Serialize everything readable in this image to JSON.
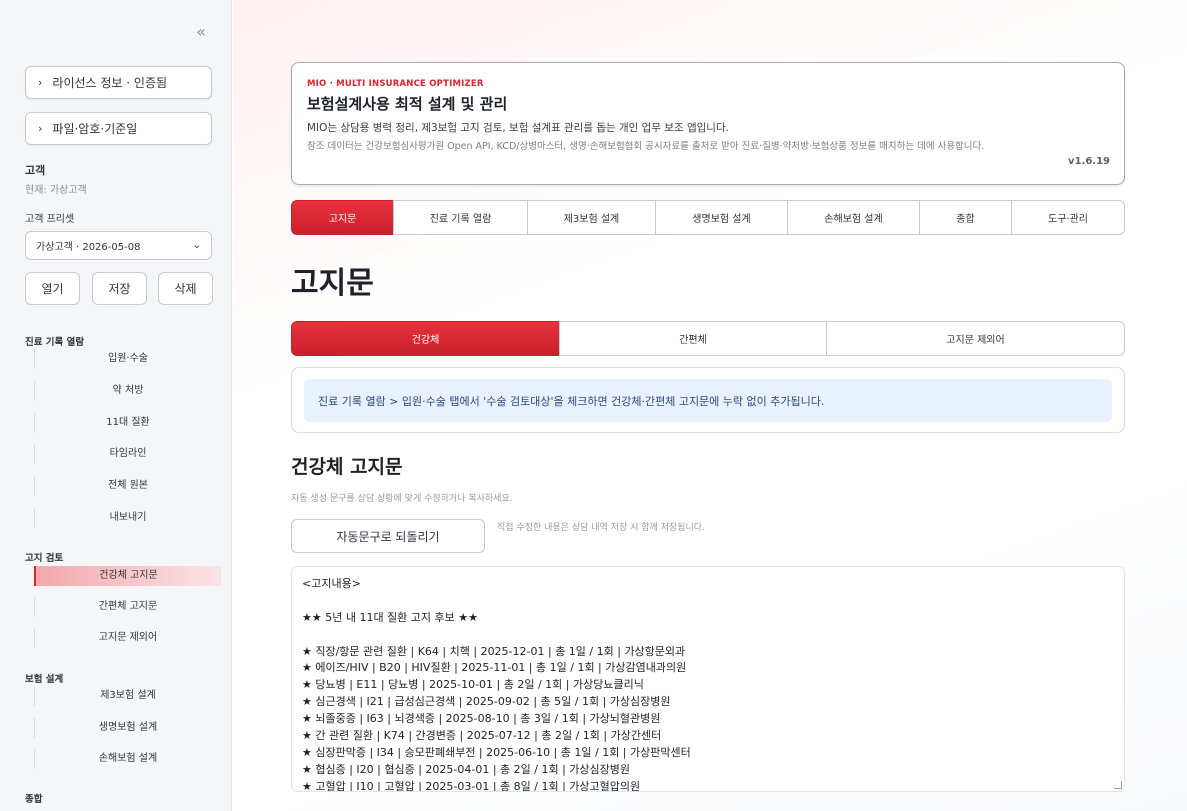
{
  "sidebar": {
    "collapse_icon": "«",
    "expanders": [
      {
        "label": "라이선스 정보 · 인증됨"
      },
      {
        "label": "파일·암호·기준일"
      }
    ],
    "customer": {
      "title": "고객",
      "current": "현재: 가상고객"
    },
    "preset": {
      "label": "고객 프리셋",
      "selected": "가상고객 · 2026-05-08"
    },
    "buttons": {
      "open": "열기",
      "save": "저장",
      "delete": "삭제"
    },
    "nav_groups": [
      {
        "title": "진료 기록 열람",
        "items": [
          "입원·수술",
          "약 처방",
          "11대 질환",
          "타임라인",
          "전체 원본",
          "내보내기"
        ]
      },
      {
        "title": "고지 검토",
        "items": [
          "건강체 고지문",
          "간편체 고지문",
          "고지문 제외어"
        ]
      },
      {
        "title": "보험 설계",
        "items": [
          "제3보험 설계",
          "생명보험 설계",
          "손해보험 설계"
        ]
      },
      {
        "title": "종합",
        "items": []
      }
    ],
    "active_nav": "건강체 고지문"
  },
  "header": {
    "eyebrow": "MIO · MULTI INSURANCE OPTIMIZER",
    "title": "보험설계사용 최적 설계 및 관리",
    "description": "MIO는 상담용 병력 정리, 제3보험 고지 검토, 보험 설계표 관리를 돕는 개인 업무 보조 앱입니다.",
    "reference": "참조 데이터는 건강보험심사평가원 Open API, KCD/상병마스터, 생명·손해보험협회 공시자료를 출처로 받아 진료·질병·약처방·보험상품 정보를 매치하는 데에 사용합니다.",
    "version": "v1.6.19"
  },
  "tabs": [
    {
      "label": "고지문",
      "active": true
    },
    {
      "label": "진료 기록 열람",
      "active": false
    },
    {
      "label": "제3보험 설계",
      "active": false
    },
    {
      "label": "생명보험 설계",
      "active": false
    },
    {
      "label": "손해보험 설계",
      "active": false
    },
    {
      "label": "종합",
      "active": false
    },
    {
      "label": "도구·관리",
      "active": false
    }
  ],
  "page_title": "고지문",
  "subtabs": [
    {
      "label": "건강체",
      "active": true
    },
    {
      "label": "간편체",
      "active": false
    },
    {
      "label": "고지문 제외어",
      "active": false
    }
  ],
  "info_message": "진료 기록 열람 > 입원·수술 탭에서 '수술 검토대상'을 체크하면 건강체·간편체 고지문에 누락 없이 추가됩니다.",
  "section": {
    "title": "건강체 고지문",
    "caption": "자동 생성 문구를 상담 상황에 맞게 수정하거나 복사하세요.",
    "reset_label": "자동문구로 되돌리기",
    "reset_note": "직접 수정한 내용은 상담 내역 저장 시 함께 저장됩니다."
  },
  "notice_text": [
    "<고지내용>",
    "",
    "★★ 5년 내 11대 질환 고지 후보 ★★",
    "",
    "★ 직장/항문 관련 질환 | K64 | 치핵 | 2025-12-01 | 총 1일 / 1회 | 가상항문외과",
    "★ 에이즈/HIV | B20 | HIV질환 | 2025-11-01 | 총 1일 / 1회 | 가상감염내과의원",
    "★ 당뇨병 | E11 | 당뇨병 | 2025-10-01 | 총 2일 / 1회 | 가상당뇨클리닉",
    "★ 심근경색 | I21 | 급성심근경색 | 2025-09-02 | 총 5일 / 1회 | 가상심장병원",
    "★ 뇌졸중증 | I63 | 뇌경색증 | 2025-08-10 | 총 3일 / 1회 | 가상뇌혈관병원",
    "★ 간 관련 질환 | K74 | 간경변증 | 2025-07-12 | 총 2일 / 1회 | 가상간센터",
    "★ 심장판막증 | I34 | 승모판폐쇄부전 | 2025-06-10 | 총 1일 / 1회 | 가상판막센터",
    "★ 협심증 | I20 | 협심증 | 2025-04-01 | 총 2일 / 1회 | 가상심장병원",
    "★ 고혈압 | I10 | 고혈압 | 2025-03-01 | 총 8일 / 1회 | 가상고혈압의원"
  ]
}
